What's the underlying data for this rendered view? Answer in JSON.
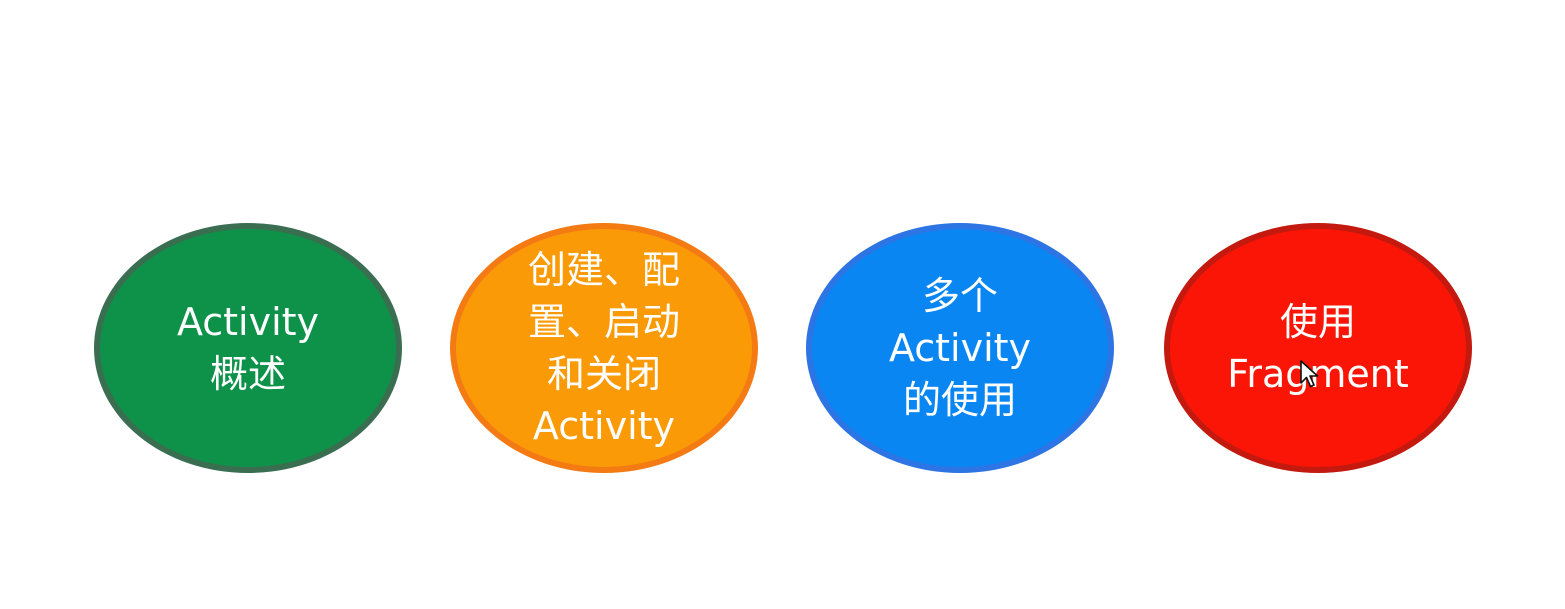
{
  "topics": [
    {
      "id": "activity-overview",
      "lines": [
        "Activity",
        "概述"
      ],
      "color": "#0e9249",
      "border_color": "#3a6e50"
    },
    {
      "id": "create-config-start-close-activity",
      "lines": [
        "创建、配",
        "置、启动",
        "和关闭",
        "Activity"
      ],
      "color": "#fb9a07",
      "border_color": "#f47a14"
    },
    {
      "id": "multiple-activity-usage",
      "lines": [
        "多个",
        "Activity",
        "的使用"
      ],
      "color": "#0a86f3",
      "border_color": "#2d74e4"
    },
    {
      "id": "use-fragment",
      "lines": [
        "使用",
        "Fragment"
      ],
      "color": "#fb1506",
      "border_color": "#c4190f"
    }
  ],
  "cursor": {
    "icon": "mouse-pointer-icon"
  }
}
